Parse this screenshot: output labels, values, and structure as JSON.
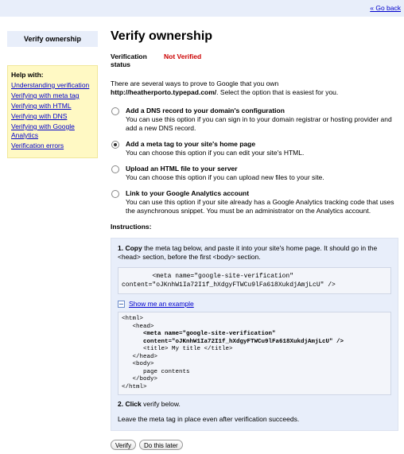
{
  "header": {
    "go_back": "« Go back"
  },
  "sidebar": {
    "title": "Verify ownership",
    "help_title": "Help with:",
    "links": [
      "Understanding verification",
      "Verifying with meta tag",
      "Verifying with HTML",
      "Verifying with DNS",
      "Verifying with Google Analytics",
      "Verification errors"
    ]
  },
  "main": {
    "title": "Verify ownership",
    "status_label": "Verification status",
    "status_value": "Not Verified",
    "intro_prefix": "There are several ways to prove to Google that you own",
    "site_url": "http://heatherporto.typepad.com/",
    "intro_suffix": ". Select the option that is easiest for you.",
    "options": [
      {
        "title": "Add a DNS record to your domain's configuration",
        "desc": "You can use this option if you can sign in to your domain registrar or hosting provider and add a new DNS record.",
        "selected": false
      },
      {
        "title": "Add a meta tag to your site's home page",
        "desc": "You can choose this option if you can edit your site's HTML.",
        "selected": true
      },
      {
        "title": "Upload an HTML file to your server",
        "desc": "You can choose this option if you can upload new files to your site.",
        "selected": false
      },
      {
        "title": "Link to your Google Analytics account",
        "desc": "You can use this option if your site already has a Google Analytics tracking code that uses the asynchronous snippet. You must be an administrator on the Analytics account.",
        "selected": false
      }
    ],
    "instructions_label": "Instructions:",
    "step1_bold": "1. Copy",
    "step1_text": " the meta tag below, and paste it into your site's home page. It should go in the <head> section, before the first <body> section.",
    "meta_tag_line1": "        <meta name=\"google-site-verification\"",
    "meta_tag_line2": "content=\"oJKnhW1Ia72I1f_hXdgyFTWCu9lFa618XukdjAmjLcU\" />",
    "example_toggle": "Show me an example",
    "example_lines": [
      "<html>",
      "   <head>",
      "      <meta name=\"google-site-verification\"",
      "      content=\"oJKnhW1Ia72I1f_hXdgyFTWCu9lFa618XukdjAmjLcU\" />",
      "      <title> My title </title>",
      "   </head>",
      "   <body>",
      "      page contents",
      "   </body>",
      "</html>"
    ],
    "step2_bold": "2. Click",
    "step2_text": " verify below.",
    "leave_text": "Leave the meta tag in place even after verification succeeds.",
    "verify_button": "Verify",
    "later_button": "Do this later"
  }
}
